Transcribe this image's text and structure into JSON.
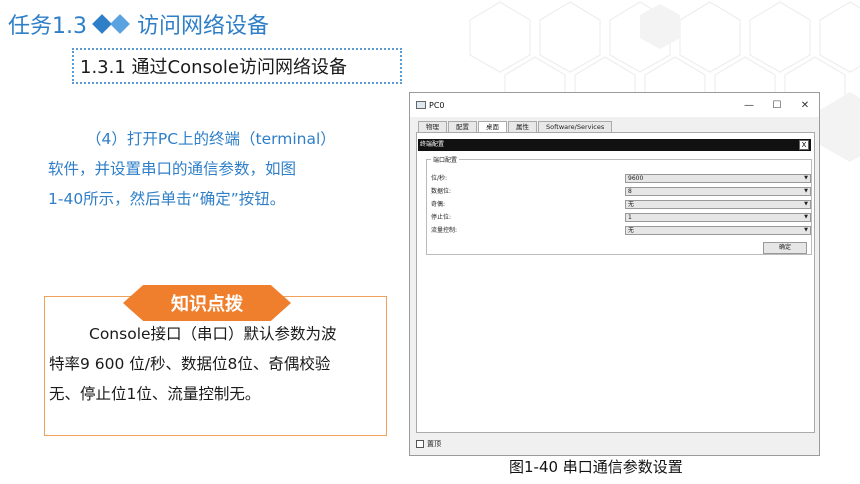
{
  "slide": {
    "task_no": "任务1.3",
    "title": "访问网络设备",
    "subsection": "1.3.1 通过Console访问网络设备"
  },
  "paragraph": {
    "lines": [
      "（4）打开PC上的终端（terminal）",
      "软件，并设置串口的通信参数，如图",
      "1-40所示，然后单击“确定”按钮。"
    ]
  },
  "knowledge": {
    "tab": "知识点拨",
    "lines": [
      "Console接口（串口）默认参数为波",
      "特率9 600 位/秒、数据位8位、奇偶校验",
      "无、停止位1位、流量控制无。"
    ]
  },
  "window": {
    "title": "PC0",
    "controls": [
      "—",
      "☐",
      "✕"
    ],
    "tabs": [
      "物理",
      "配置",
      "桌面",
      "属性",
      "Software/Services"
    ],
    "active_tab": "桌面",
    "terminal_title": "终端配置",
    "close_label": "X",
    "group_title": "端口配置",
    "fields": [
      {
        "label": "位/秒:",
        "value": "9600"
      },
      {
        "label": "数据位:",
        "value": "8"
      },
      {
        "label": "奇偶:",
        "value": "无"
      },
      {
        "label": "停止位:",
        "value": "1"
      },
      {
        "label": "流量控制:",
        "value": "无"
      }
    ],
    "ok_button": "确定",
    "footer_checkbox": "置顶"
  },
  "caption": "图1-40 串口通信参数设置",
  "colors": {
    "accent_blue": "#2f7fc8",
    "orange": "#ef7f2d"
  }
}
